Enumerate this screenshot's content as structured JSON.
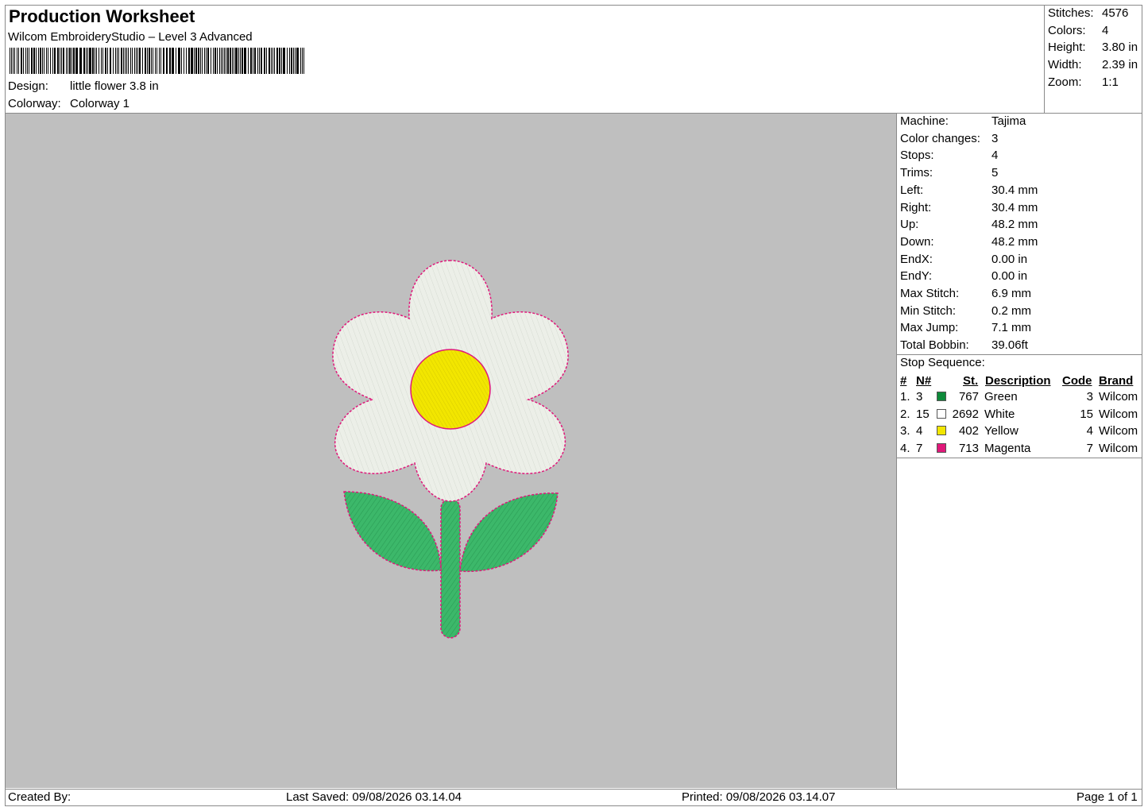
{
  "header": {
    "title": "Production Worksheet",
    "software": "Wilcom EmbroideryStudio – Level 3 Advanced",
    "design_label": "Design:",
    "design_value": "little flower 3.8 in",
    "colorway_label": "Colorway:",
    "colorway_value": "Colorway 1"
  },
  "summary": [
    {
      "label": "Stitches:",
      "value": "4576"
    },
    {
      "label": "Colors:",
      "value": "4"
    },
    {
      "label": "Height:",
      "value": "3.80 in"
    },
    {
      "label": "Width:",
      "value": "2.39 in"
    },
    {
      "label": "Zoom:",
      "value": "1:1"
    }
  ],
  "details": [
    {
      "label": "Machine:",
      "value": "Tajima"
    },
    {
      "label": "Color changes:",
      "value": "3"
    },
    {
      "label": "Stops:",
      "value": "4"
    },
    {
      "label": "Trims:",
      "value": "5"
    },
    {
      "label": "Left:",
      "value": "30.4 mm"
    },
    {
      "label": "Right:",
      "value": "30.4 mm"
    },
    {
      "label": "Up:",
      "value": "48.2 mm"
    },
    {
      "label": "Down:",
      "value": "48.2 mm"
    },
    {
      "label": "EndX:",
      "value": "0.00 in"
    },
    {
      "label": "EndY:",
      "value": "0.00 in"
    },
    {
      "label": "Max Stitch:",
      "value": "6.9 mm"
    },
    {
      "label": "Min Stitch:",
      "value": "0.2 mm"
    },
    {
      "label": "Max Jump:",
      "value": "7.1 mm"
    },
    {
      "label": "Total Bobbin:",
      "value": "39.06ft"
    }
  ],
  "stop_sequence": {
    "title": "Stop Sequence:",
    "headers": {
      "num": "#",
      "n": "N#",
      "st": "St.",
      "description": "Description",
      "code": "Code",
      "brand": "Brand"
    },
    "rows": [
      {
        "num": "1.",
        "n": "3",
        "color": "#0e8a3a",
        "st": "767",
        "description": "Green",
        "code": "3",
        "brand": "Wilcom"
      },
      {
        "num": "2.",
        "n": "15",
        "color": "#ffffff",
        "st": "2692",
        "description": "White",
        "code": "15",
        "brand": "Wilcom"
      },
      {
        "num": "3.",
        "n": "4",
        "color": "#f2e600",
        "st": "402",
        "description": "Yellow",
        "code": "4",
        "brand": "Wilcom"
      },
      {
        "num": "4.",
        "n": "7",
        "color": "#e0187a",
        "st": "713",
        "description": "Magenta",
        "code": "7",
        "brand": "Wilcom"
      }
    ]
  },
  "footer": {
    "created_by": "Created By:",
    "last_saved": "Last Saved: 09/08/2026 03.14.04",
    "printed": "Printed: 09/08/2026 03.14.07",
    "page": "Page 1 of 1"
  },
  "design_colors": {
    "canvas": "#bfbfbf",
    "petals": "#ecefe8",
    "center": "#f2e600",
    "leaves": "#3cb86a",
    "outline": "#e0187a"
  }
}
